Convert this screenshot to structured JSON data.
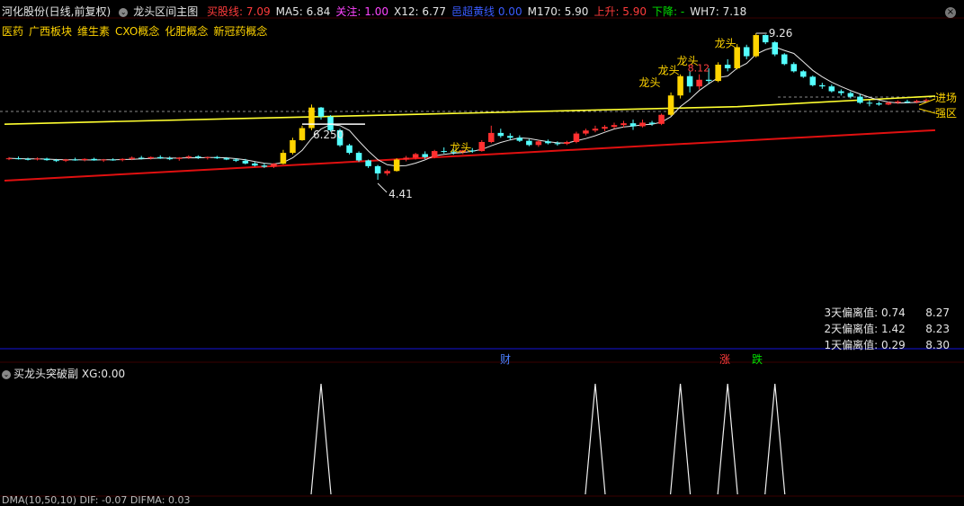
{
  "header": {
    "stock_title": "河化股份(日线,前复权)",
    "indicator_name": "龙头区间主图",
    "items": [
      {
        "label": "买股线:",
        "value": "7.09",
        "color": "#ff3b3b"
      },
      {
        "label": "MA5:",
        "value": "6.84",
        "color": "#e6e6e6"
      },
      {
        "label": "关注:",
        "value": "1.00",
        "color": "#ff44ff"
      },
      {
        "label": "X12:",
        "value": "6.77",
        "color": "#e6e6e6"
      },
      {
        "label": "邑超黄线",
        "value": "0.00",
        "color": "#3a5bff"
      },
      {
        "label": "M170:",
        "value": "5.90",
        "color": "#e6e6e6"
      },
      {
        "label": "上升:",
        "value": "5.90",
        "color": "#ff3b3b"
      },
      {
        "label": "下降:",
        "value": "-",
        "color": "#00e000"
      },
      {
        "label": "WH7:",
        "value": "7.18",
        "color": "#e6e6e6"
      }
    ]
  },
  "concept_tags": [
    "医药",
    "广西板块",
    "维生素",
    "CXO概念",
    "化肥概念",
    "新冠药概念"
  ],
  "right_labels": {
    "enter": "进场",
    "strong": "强区"
  },
  "deviation": [
    {
      "label": "3天偏离值:",
      "v1": "0.74",
      "v2": "8.27"
    },
    {
      "label": "2天偏离值:",
      "v1": "1.42",
      "v2": "8.23"
    },
    {
      "label": "1天偏离值:",
      "v1": "0.29",
      "v2": "8.30"
    }
  ],
  "event_markers": [
    {
      "text": "财",
      "color": "#4a7fff"
    },
    {
      "text": "涨",
      "color": "#ff3b3b"
    },
    {
      "text": "跌",
      "color": "#00e000"
    }
  ],
  "sub_panel": {
    "title": "买龙头突破副",
    "xg_label": "XG:",
    "xg_value": "0.00"
  },
  "bottom_panel_text": "DMA(10,50,10) DIF: -0.07 DIFMA: 0.03",
  "chart_data": {
    "type": "candlestick",
    "y_axis_log": false,
    "annotations": {
      "high_label": "9.26",
      "low_label": "4.41",
      "level_label": "6.250",
      "level_value": 6.25,
      "dragon_head_labels": [
        "龙头",
        "龙头",
        "龙头",
        "龙头",
        "龙头"
      ],
      "small_label": "8.12"
    },
    "candles": [
      {
        "o": 5.1,
        "h": 5.16,
        "l": 5.06,
        "c": 5.12
      },
      {
        "o": 5.12,
        "h": 5.18,
        "l": 5.08,
        "c": 5.1
      },
      {
        "o": 5.1,
        "h": 5.14,
        "l": 5.05,
        "c": 5.08
      },
      {
        "o": 5.08,
        "h": 5.15,
        "l": 5.05,
        "c": 5.11
      },
      {
        "o": 5.11,
        "h": 5.14,
        "l": 5.04,
        "c": 5.06
      },
      {
        "o": 5.06,
        "h": 5.1,
        "l": 5.0,
        "c": 5.04
      },
      {
        "o": 5.04,
        "h": 5.1,
        "l": 5.0,
        "c": 5.08
      },
      {
        "o": 5.08,
        "h": 5.14,
        "l": 5.04,
        "c": 5.06
      },
      {
        "o": 5.06,
        "h": 5.12,
        "l": 5.02,
        "c": 5.1
      },
      {
        "o": 5.1,
        "h": 5.14,
        "l": 5.04,
        "c": 5.05
      },
      {
        "o": 5.05,
        "h": 5.1,
        "l": 5.0,
        "c": 5.08
      },
      {
        "o": 5.08,
        "h": 5.12,
        "l": 5.04,
        "c": 5.06
      },
      {
        "o": 5.06,
        "h": 5.12,
        "l": 5.02,
        "c": 5.1
      },
      {
        "o": 5.1,
        "h": 5.18,
        "l": 5.06,
        "c": 5.14
      },
      {
        "o": 5.14,
        "h": 5.2,
        "l": 5.08,
        "c": 5.12
      },
      {
        "o": 5.12,
        "h": 5.18,
        "l": 5.08,
        "c": 5.16
      },
      {
        "o": 5.16,
        "h": 5.22,
        "l": 5.1,
        "c": 5.12
      },
      {
        "o": 5.12,
        "h": 5.18,
        "l": 5.06,
        "c": 5.1
      },
      {
        "o": 5.1,
        "h": 5.16,
        "l": 5.04,
        "c": 5.14
      },
      {
        "o": 5.14,
        "h": 5.22,
        "l": 5.1,
        "c": 5.18
      },
      {
        "o": 5.18,
        "h": 5.22,
        "l": 5.1,
        "c": 5.14
      },
      {
        "o": 5.14,
        "h": 5.18,
        "l": 5.08,
        "c": 5.16
      },
      {
        "o": 5.16,
        "h": 5.2,
        "l": 5.1,
        "c": 5.12
      },
      {
        "o": 5.12,
        "h": 5.16,
        "l": 5.06,
        "c": 5.08
      },
      {
        "o": 5.08,
        "h": 5.12,
        "l": 5.0,
        "c": 5.04
      },
      {
        "o": 5.04,
        "h": 5.1,
        "l": 4.92,
        "c": 4.95
      },
      {
        "o": 4.95,
        "h": 5.0,
        "l": 4.85,
        "c": 4.88
      },
      {
        "o": 4.88,
        "h": 4.95,
        "l": 4.8,
        "c": 4.84
      },
      {
        "o": 4.84,
        "h": 4.96,
        "l": 4.8,
        "c": 4.94
      },
      {
        "o": 4.94,
        "h": 5.4,
        "l": 4.92,
        "c": 5.3
      },
      {
        "o": 5.3,
        "h": 5.8,
        "l": 5.25,
        "c": 5.72
      },
      {
        "o": 5.72,
        "h": 6.2,
        "l": 5.7,
        "c": 6.12
      },
      {
        "o": 6.12,
        "h": 6.9,
        "l": 6.05,
        "c": 6.8
      },
      {
        "o": 6.8,
        "h": 6.82,
        "l": 6.4,
        "c": 6.5
      },
      {
        "o": 6.5,
        "h": 6.55,
        "l": 6.0,
        "c": 6.05
      },
      {
        "o": 6.05,
        "h": 6.1,
        "l": 5.5,
        "c": 5.55
      },
      {
        "o": 5.55,
        "h": 5.6,
        "l": 5.25,
        "c": 5.3
      },
      {
        "o": 5.3,
        "h": 5.35,
        "l": 5.0,
        "c": 5.05
      },
      {
        "o": 5.05,
        "h": 5.08,
        "l": 4.8,
        "c": 4.86
      },
      {
        "o": 4.86,
        "h": 4.9,
        "l": 4.41,
        "c": 4.62
      },
      {
        "o": 4.62,
        "h": 4.75,
        "l": 4.55,
        "c": 4.7
      },
      {
        "o": 4.7,
        "h": 5.12,
        "l": 4.68,
        "c": 5.08
      },
      {
        "o": 5.08,
        "h": 5.2,
        "l": 5.02,
        "c": 5.14
      },
      {
        "o": 5.14,
        "h": 5.3,
        "l": 5.08,
        "c": 5.26
      },
      {
        "o": 5.26,
        "h": 5.35,
        "l": 5.1,
        "c": 5.16
      },
      {
        "o": 5.16,
        "h": 5.4,
        "l": 5.12,
        "c": 5.36
      },
      {
        "o": 5.36,
        "h": 5.48,
        "l": 5.28,
        "c": 5.34
      },
      {
        "o": 5.34,
        "h": 5.42,
        "l": 5.24,
        "c": 5.32
      },
      {
        "o": 5.32,
        "h": 5.4,
        "l": 5.26,
        "c": 5.38
      },
      {
        "o": 5.38,
        "h": 5.46,
        "l": 5.3,
        "c": 5.36
      },
      {
        "o": 5.36,
        "h": 5.72,
        "l": 5.34,
        "c": 5.66
      },
      {
        "o": 5.66,
        "h": 6.2,
        "l": 5.62,
        "c": 5.96
      },
      {
        "o": 5.96,
        "h": 6.1,
        "l": 5.8,
        "c": 5.86
      },
      {
        "o": 5.86,
        "h": 5.95,
        "l": 5.72,
        "c": 5.8
      },
      {
        "o": 5.8,
        "h": 5.88,
        "l": 5.66,
        "c": 5.7
      },
      {
        "o": 5.7,
        "h": 5.76,
        "l": 5.52,
        "c": 5.56
      },
      {
        "o": 5.56,
        "h": 5.72,
        "l": 5.5,
        "c": 5.68
      },
      {
        "o": 5.68,
        "h": 5.74,
        "l": 5.58,
        "c": 5.62
      },
      {
        "o": 5.62,
        "h": 5.68,
        "l": 5.54,
        "c": 5.6
      },
      {
        "o": 5.6,
        "h": 5.7,
        "l": 5.56,
        "c": 5.66
      },
      {
        "o": 5.66,
        "h": 6.0,
        "l": 5.62,
        "c": 5.94
      },
      {
        "o": 5.94,
        "h": 6.1,
        "l": 5.88,
        "c": 6.04
      },
      {
        "o": 6.04,
        "h": 6.2,
        "l": 5.98,
        "c": 6.1
      },
      {
        "o": 6.1,
        "h": 6.22,
        "l": 6.02,
        "c": 6.16
      },
      {
        "o": 6.16,
        "h": 6.3,
        "l": 6.1,
        "c": 6.22
      },
      {
        "o": 6.22,
        "h": 6.36,
        "l": 6.14,
        "c": 6.28
      },
      {
        "o": 6.28,
        "h": 6.4,
        "l": 6.06,
        "c": 6.18
      },
      {
        "o": 6.18,
        "h": 6.4,
        "l": 6.14,
        "c": 6.3
      },
      {
        "o": 6.3,
        "h": 6.36,
        "l": 6.2,
        "c": 6.26
      },
      {
        "o": 6.26,
        "h": 6.6,
        "l": 6.22,
        "c": 6.56
      },
      {
        "o": 6.56,
        "h": 7.3,
        "l": 6.52,
        "c": 7.2
      },
      {
        "o": 7.2,
        "h": 7.9,
        "l": 7.1,
        "c": 7.84
      },
      {
        "o": 7.84,
        "h": 8.0,
        "l": 7.3,
        "c": 7.5
      },
      {
        "o": 7.5,
        "h": 7.9,
        "l": 7.4,
        "c": 7.72
      },
      {
        "o": 7.72,
        "h": 8.1,
        "l": 7.6,
        "c": 7.68
      },
      {
        "o": 7.68,
        "h": 8.3,
        "l": 7.64,
        "c": 8.22
      },
      {
        "o": 8.22,
        "h": 8.4,
        "l": 8.0,
        "c": 8.1
      },
      {
        "o": 8.1,
        "h": 8.9,
        "l": 8.06,
        "c": 8.8
      },
      {
        "o": 8.8,
        "h": 8.88,
        "l": 8.4,
        "c": 8.5
      },
      {
        "o": 8.5,
        "h": 9.26,
        "l": 8.46,
        "c": 9.2
      },
      {
        "o": 9.2,
        "h": 9.22,
        "l": 8.9,
        "c": 8.96
      },
      {
        "o": 8.96,
        "h": 9.0,
        "l": 8.5,
        "c": 8.56
      },
      {
        "o": 8.56,
        "h": 8.6,
        "l": 8.2,
        "c": 8.24
      },
      {
        "o": 8.24,
        "h": 8.3,
        "l": 7.96,
        "c": 8.0
      },
      {
        "o": 8.0,
        "h": 8.04,
        "l": 7.78,
        "c": 7.82
      },
      {
        "o": 7.82,
        "h": 7.86,
        "l": 7.5,
        "c": 7.54
      },
      {
        "o": 7.54,
        "h": 7.62,
        "l": 7.42,
        "c": 7.5
      },
      {
        "o": 7.5,
        "h": 7.56,
        "l": 7.3,
        "c": 7.34
      },
      {
        "o": 7.34,
        "h": 7.4,
        "l": 7.2,
        "c": 7.28
      },
      {
        "o": 7.28,
        "h": 7.34,
        "l": 7.1,
        "c": 7.16
      },
      {
        "o": 7.16,
        "h": 7.24,
        "l": 6.92,
        "c": 6.96
      },
      {
        "o": 6.96,
        "h": 7.04,
        "l": 6.84,
        "c": 6.94
      },
      {
        "o": 6.94,
        "h": 7.0,
        "l": 6.86,
        "c": 6.9
      },
      {
        "o": 6.9,
        "h": 7.0,
        "l": 6.88,
        "c": 6.96
      },
      {
        "o": 6.96,
        "h": 7.04,
        "l": 6.92,
        "c": 7.0
      },
      {
        "o": 7.0,
        "h": 7.06,
        "l": 6.94,
        "c": 6.98
      },
      {
        "o": 6.98,
        "h": 7.06,
        "l": 6.94,
        "c": 7.02
      },
      {
        "o": 7.02,
        "h": 7.1,
        "l": 6.98,
        "c": 7.05
      }
    ],
    "lines": {
      "yellow": {
        "start": 6.25,
        "end": 7.18
      },
      "red": {
        "start": 4.38,
        "end": 6.05
      },
      "white_ma_note": "MA curve"
    },
    "sub_chart": {
      "type": "spike",
      "spike_positions": [
        33,
        62,
        71,
        76,
        81
      ],
      "spike_value": 1,
      "baseline": 0
    }
  }
}
